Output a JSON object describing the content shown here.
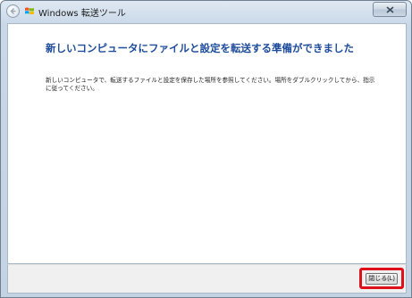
{
  "window": {
    "title": "Windows 転送ツール"
  },
  "main": {
    "heading": "新しいコンピュータにファイルと設定を転送する準備ができました",
    "body": "新しいコンピュータで、転送するファイルと設定を保存した場所を参照してください。場所をダブルクリックしてから、指示に従ってください。"
  },
  "footer": {
    "close_label": "閉じる(L)"
  },
  "icons": {
    "back": "back-arrow-icon",
    "app": "windows-logo-icon",
    "close": "close-x-icon"
  },
  "colors": {
    "heading": "#1e4c9c",
    "highlight": "#e0101a"
  }
}
